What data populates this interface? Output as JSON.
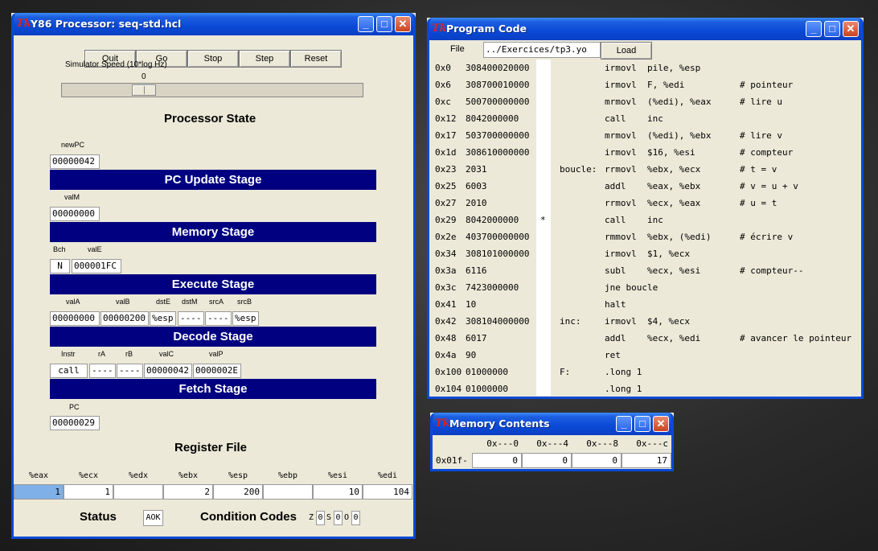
{
  "y86": {
    "title": "Y86 Processor: seq-std.hcl",
    "icon": "tk-icon",
    "buttons": [
      "Quit",
      "Go",
      "Stop",
      "Step",
      "Reset"
    ],
    "speed_label": "Simulator Speed (10*log Hz)",
    "speed_value": "0",
    "processor_state": "Processor State",
    "newpc_label": "newPC",
    "newpc": "00000042",
    "pc_update_stage": "PC Update Stage",
    "valm_label": "valM",
    "valm": "00000000",
    "memory_stage": "Memory Stage",
    "bch_label": "Bch",
    "bch": "N",
    "vale_label": "valE",
    "vale": "000001FC",
    "execute_stage": "Execute Stage",
    "decode_labels": [
      "valA",
      "valB",
      "dstE",
      "dstM",
      "srcA",
      "srcB"
    ],
    "decode_values": [
      "00000000",
      "00000200",
      "%esp",
      "----",
      "----",
      "%esp"
    ],
    "decode_stage": "Decode Stage",
    "fetch_labels": [
      "Instr",
      "rA",
      "rB",
      "valC",
      "valP"
    ],
    "fetch_values": [
      "call",
      "----",
      "----",
      "00000042",
      "0000002E"
    ],
    "fetch_stage": "Fetch Stage",
    "pc_label": "PC",
    "pc": "00000029",
    "register_file": "Register File",
    "registers": [
      {
        "name": "%eax",
        "value": "1"
      },
      {
        "name": "%ecx",
        "value": "1"
      },
      {
        "name": "%edx",
        "value": ""
      },
      {
        "name": "%ebx",
        "value": "2"
      },
      {
        "name": "%esp",
        "value": "200"
      },
      {
        "name": "%ebp",
        "value": ""
      },
      {
        "name": "%esi",
        "value": "10"
      },
      {
        "name": "%edi",
        "value": "104"
      }
    ],
    "status_label": "Status",
    "status": "AOK",
    "cc_label": "Condition Codes",
    "cc": [
      {
        "flag": "Z",
        "value": "0"
      },
      {
        "flag": "S",
        "value": "0"
      },
      {
        "flag": "O",
        "value": "0"
      }
    ]
  },
  "program": {
    "title": "Program Code",
    "file_label": "File",
    "file_path": "../Exercices/tp3.yo",
    "load_label": "Load",
    "rows": [
      {
        "addr": "0x0",
        "hex": "308400020000",
        "mark": "",
        "label": "",
        "instr": "irmovl  pile, %esp",
        "comment": ""
      },
      {
        "addr": "0x6",
        "hex": "308700010000",
        "mark": "",
        "label": "",
        "instr": "irmovl  F, %edi",
        "comment": "# pointeur"
      },
      {
        "addr": "0xc",
        "hex": "500700000000",
        "mark": "",
        "label": "",
        "instr": "mrmovl  (%edi), %eax",
        "comment": "# lire u"
      },
      {
        "addr": "0x12",
        "hex": "8042000000",
        "mark": "",
        "label": "",
        "instr": "call    inc",
        "comment": ""
      },
      {
        "addr": "0x17",
        "hex": "503700000000",
        "mark": "",
        "label": "",
        "instr": "mrmovl  (%edi), %ebx",
        "comment": "# lire v"
      },
      {
        "addr": "0x1d",
        "hex": "308610000000",
        "mark": "",
        "label": "",
        "instr": "irmovl  $16, %esi",
        "comment": "# compteur"
      },
      {
        "addr": "0x23",
        "hex": "2031",
        "mark": "",
        "label": "boucle:",
        "instr": "rrmovl  %ebx, %ecx",
        "comment": "# t = v"
      },
      {
        "addr": "0x25",
        "hex": "6003",
        "mark": "",
        "label": "",
        "instr": "addl    %eax, %ebx",
        "comment": "# v = u + v"
      },
      {
        "addr": "0x27",
        "hex": "2010",
        "mark": "",
        "label": "",
        "instr": "rrmovl  %ecx, %eax",
        "comment": "# u = t"
      },
      {
        "addr": "0x29",
        "hex": "8042000000",
        "mark": "*",
        "label": "",
        "instr": "call    inc",
        "comment": ""
      },
      {
        "addr": "0x2e",
        "hex": "403700000000",
        "mark": "",
        "label": "",
        "instr": "rmmovl  %ebx, (%edi)",
        "comment": "# écrire v"
      },
      {
        "addr": "0x34",
        "hex": "308101000000",
        "mark": "",
        "label": "",
        "instr": "irmovl  $1, %ecx",
        "comment": ""
      },
      {
        "addr": "0x3a",
        "hex": "6116",
        "mark": "",
        "label": "",
        "instr": "subl    %ecx, %esi",
        "comment": "# compteur--"
      },
      {
        "addr": "0x3c",
        "hex": "7423000000",
        "mark": "",
        "label": "",
        "instr": "jne boucle",
        "comment": ""
      },
      {
        "addr": "0x41",
        "hex": "10",
        "mark": "",
        "label": "",
        "instr": "halt",
        "comment": ""
      },
      {
        "addr": "0x42",
        "hex": "308104000000",
        "mark": "",
        "label": "inc:",
        "instr": "irmovl  $4, %ecx",
        "comment": ""
      },
      {
        "addr": "0x48",
        "hex": "6017",
        "mark": "",
        "label": "",
        "instr": "addl    %ecx, %edi",
        "comment": "# avancer le pointeur"
      },
      {
        "addr": "0x4a",
        "hex": "90",
        "mark": "",
        "label": "",
        "instr": "ret",
        "comment": ""
      },
      {
        "addr": "0x100",
        "hex": "01000000",
        "mark": "",
        "label": "F:",
        "instr": ".long 1",
        "comment": ""
      },
      {
        "addr": "0x104",
        "hex": "01000000",
        "mark": "",
        "label": "",
        "instr": ".long 1",
        "comment": ""
      }
    ]
  },
  "memory": {
    "title": "Memory Contents",
    "columns": [
      "0x---0",
      "0x---4",
      "0x---8",
      "0x---c"
    ],
    "row_label": "0x01f-",
    "values": [
      "0",
      "0",
      "0",
      "17"
    ]
  },
  "colors": {
    "stage_bg": "#000080",
    "title_blue": "#0a49d6",
    "window_bg": "#ece9d8",
    "selected_reg": "#7fb0e8"
  }
}
